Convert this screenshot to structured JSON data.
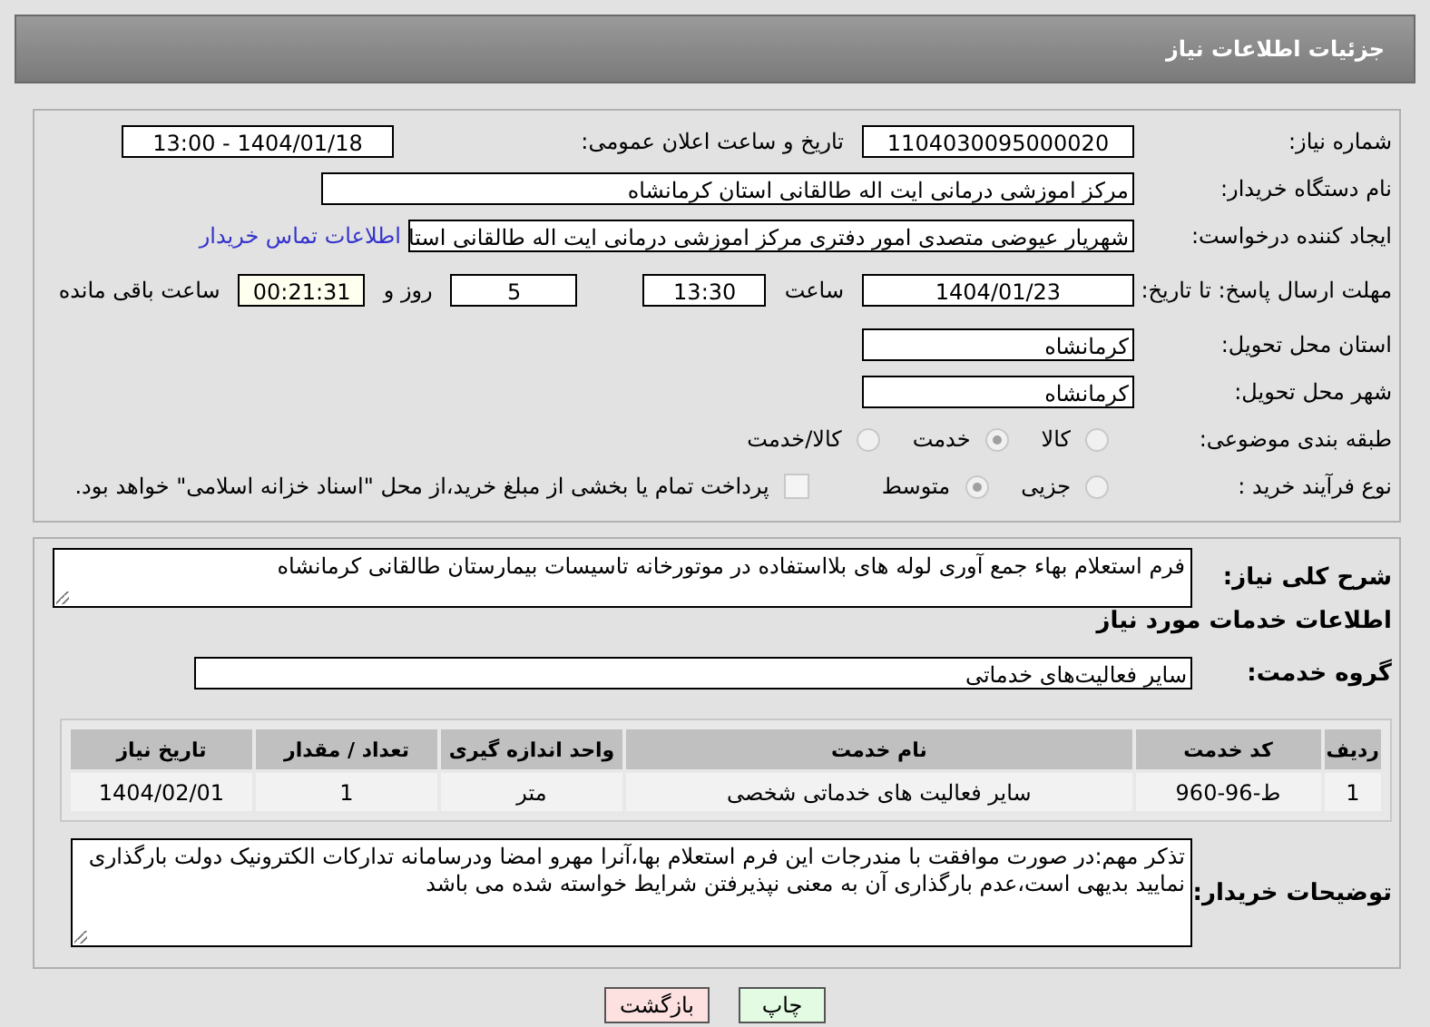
{
  "header": {
    "title": "جزئیات اطلاعات نیاز"
  },
  "need_number": {
    "label": "شماره نیاز:",
    "value": "1104030095000020"
  },
  "announce_date": {
    "label": "تاریخ و ساعت اعلان عمومی:",
    "value": "1404/01/18 - 13:00"
  },
  "buyer_org": {
    "label": "نام دستگاه خریدار:",
    "value": "مرکز اموزشی درمانی ایت اله طالقانی استان کرمانشاه"
  },
  "requester": {
    "label": "ایجاد کننده درخواست:",
    "value": "شهریار عیوضی متصدی امور دفتری مرکز اموزشی درمانی ایت اله طالقانی استا",
    "link": "اطلاعات تماس خریدار"
  },
  "deadline": {
    "label": "مهلت ارسال پاسخ: تا تاریخ:",
    "date": "1404/01/23",
    "time_label": "ساعت",
    "time": "13:30",
    "days": "5",
    "days_label": "روز و",
    "remaining": "00:21:31",
    "remaining_label": "ساعت باقی مانده"
  },
  "province": {
    "label": "استان محل تحویل:",
    "value": "کرمانشاه"
  },
  "city": {
    "label": "شهر محل تحویل:",
    "value": "کرمانشاه"
  },
  "category": {
    "label": "طبقه بندی موضوعی:",
    "options": [
      {
        "label": "کالا",
        "selected": false
      },
      {
        "label": "خدمت",
        "selected": true
      },
      {
        "label": "کالا/خدمت",
        "selected": false
      }
    ]
  },
  "purchase_type": {
    "label": "نوع فرآیند خرید :",
    "options": [
      {
        "label": "جزیی",
        "selected": false
      },
      {
        "label": "متوسط",
        "selected": true
      }
    ],
    "payment": {
      "checked": false,
      "text": "پرداخت تمام یا بخشی از مبلغ خرید،از محل \"اسناد خزانه اسلامی\" خواهد بود."
    }
  },
  "description": {
    "label": "شرح کلی نیاز:",
    "value": "فرم استعلام بهاء جمع آوری لوله های بلااستفاده در موتورخانه تاسیسات بیمارستان طالقانی کرمانشاه"
  },
  "services_heading": "اطلاعات خدمات مورد نیاز",
  "service_group": {
    "label": "گروه خدمت:",
    "value": "سایر فعالیت‌های خدماتی"
  },
  "table": {
    "columns": [
      "ردیف",
      "کد خدمت",
      "نام خدمت",
      "واحد اندازه گیری",
      "تعداد / مقدار",
      "تاریخ نیاز"
    ],
    "rows": [
      [
        "1",
        "ط-96-960",
        "سایر فعالیت های خدماتی شخصی",
        "متر",
        "1",
        "1404/02/01"
      ]
    ]
  },
  "buyer_notes": {
    "label": "توضیحات خریدار:",
    "value": "تذکر مهم:در صورت موافقت با مندرجات این فرم استعلام بها،آنرا مهرو امضا ودرسامانه تدارکات الکترونیک دولت بارگذاری نمایید بدیهی است،عدم بارگذاری آن به معنی نپذیرفتن شرایط خواسته شده می باشد"
  },
  "buttons": [
    {
      "label": "چاپ",
      "kind": "print"
    },
    {
      "label": "بازگشت",
      "kind": "back"
    }
  ]
}
